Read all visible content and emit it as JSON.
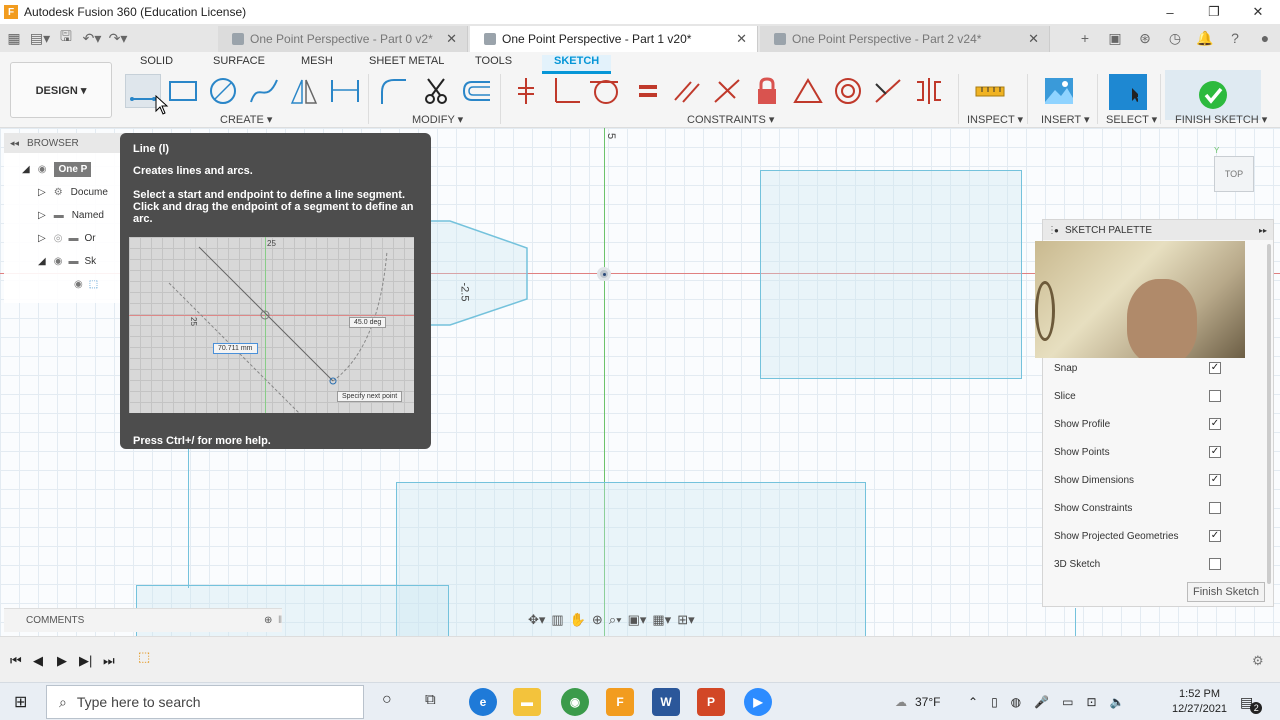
{
  "window": {
    "logo": "F",
    "title": "Autodesk Fusion 360 (Education License)",
    "minimize": "–",
    "restore": "❐",
    "close": "✕"
  },
  "tabs": [
    {
      "label": "One Point Perspective - Part 0 v2*",
      "active": false
    },
    {
      "label": "One Point Perspective - Part 1 v20*",
      "active": true
    },
    {
      "label": "One Point Perspective - Part 2 v24*",
      "active": false
    }
  ],
  "tab_close": "✕",
  "tab_add": "+",
  "toolbar": {
    "design": "DESIGN ▾",
    "modes": [
      "SOLID",
      "SURFACE",
      "MESH",
      "SHEET METAL",
      "TOOLS",
      "SKETCH"
    ],
    "groups": {
      "create": "CREATE ▾",
      "modify": "MODIFY ▾",
      "constraints": "CONSTRAINTS ▾",
      "inspect": "INSPECT ▾",
      "insert": "INSERT ▾",
      "select": "SELECT ▾",
      "finish": "FINISH SKETCH ▾"
    }
  },
  "browser": {
    "title": "BROWSER",
    "items": [
      "One P",
      "Docume",
      "Named",
      "Or",
      "Sk"
    ]
  },
  "tooltip": {
    "title": "Line (l)",
    "subtitle": "Creates lines and arcs.",
    "description": "Select a start and endpoint to define a line segment. Click and drag the endpoint of a segment to define an arc.",
    "image_dim_length": "70.711 mm",
    "image_dim_angle": "45.0 deg",
    "image_prompt": "Specify next point",
    "image_tick_top": "25",
    "image_tick_left": "25",
    "footer": "Press Ctrl+/ for more help."
  },
  "canvas": {
    "dim_top": "5",
    "dim_side": "-2.5",
    "viewcube": "TOP"
  },
  "palette": {
    "title": "SKETCH PALETTE",
    "options": [
      {
        "label": "Snap",
        "checked": true
      },
      {
        "label": "Slice",
        "checked": false
      },
      {
        "label": "Show Profile",
        "checked": true
      },
      {
        "label": "Show Points",
        "checked": true
      },
      {
        "label": "Show Dimensions",
        "checked": true
      },
      {
        "label": "Show Constraints",
        "checked": false
      },
      {
        "label": "Show Projected Geometries",
        "checked": true
      },
      {
        "label": "3D Sketch",
        "checked": false
      }
    ],
    "finish": "Finish Sketch"
  },
  "comments": {
    "label": "COMMENTS"
  },
  "taskbar": {
    "search_placeholder": "Type here to search",
    "weather": "37°F",
    "time": "1:52 PM",
    "date": "12/27/2021",
    "notifications": "2"
  },
  "colors": {
    "accent": "#0696d7",
    "sketch_line": "#74c2dc",
    "x_axis": "#e08080",
    "y_axis": "#6cc36c",
    "finish_green": "#2dba3e"
  }
}
